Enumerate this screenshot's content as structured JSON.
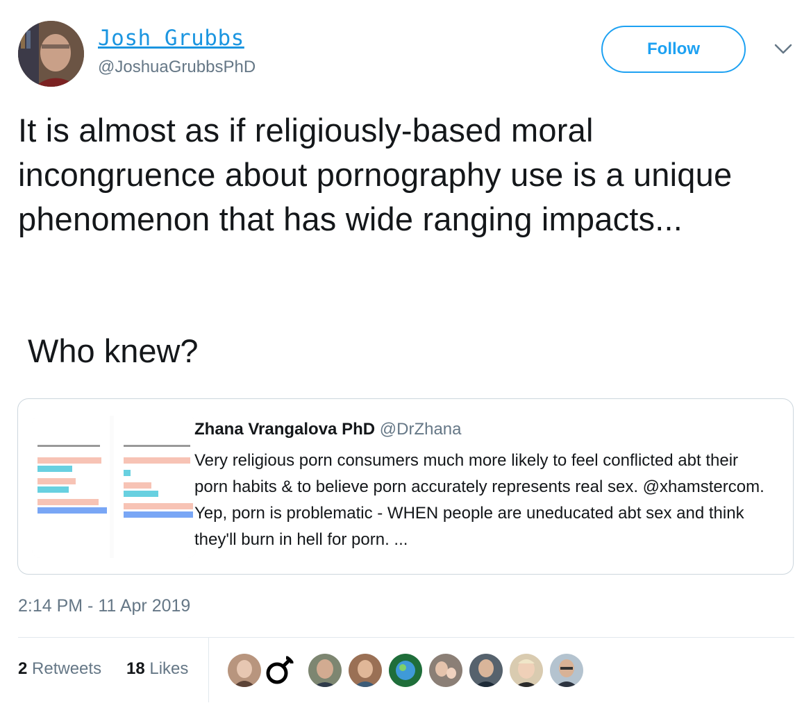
{
  "author": {
    "display_name": "Josh Grubbs",
    "handle": "@JoshuaGrubbsPhD"
  },
  "follow_label": "Follow",
  "tweet": {
    "text": "It is almost as if religiously-based moral incongruence about pornography use is a unique phenomenon that has wide ranging impacts...",
    "text2": "Who knew?"
  },
  "quote": {
    "name": "Zhana Vrangalova PhD",
    "handle": "@DrZhana",
    "text": "Very religious porn consumers much more likely to feel conflicted abt their porn habits & to believe porn accurately represents real sex. @xhamstercom. Yep, porn is problematic - WHEN people are uneducated abt sex and think they'll burn in hell for porn. ..."
  },
  "timestamp": "2:14 PM - 11 Apr 2019",
  "stats": {
    "retweets_count": "2",
    "retweets_label": "Retweets",
    "likes_count": "18",
    "likes_label": "Likes"
  },
  "colors": {
    "accent": "#1da1f2",
    "link": "#1b95e0",
    "muted": "#657786"
  }
}
